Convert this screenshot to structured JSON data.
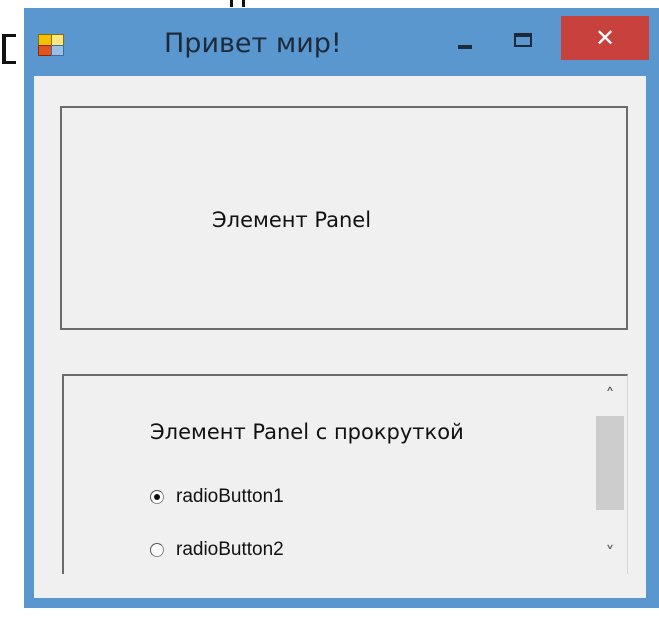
{
  "window": {
    "title": "Привет мир!",
    "close_glyph": "✕"
  },
  "panel1": {
    "label": "Элемент Panel"
  },
  "panel2": {
    "label": "Элемент Panel с прокруткой",
    "radios": [
      {
        "label": "radioButton1",
        "checked": true
      },
      {
        "label": "radioButton2",
        "checked": false
      }
    ],
    "scroll": {
      "up_glyph": "˄",
      "down_glyph": "˅"
    }
  },
  "colors": {
    "frame": "#5b97cf",
    "client": "#f0f0f0",
    "close_button": "#c9413c"
  },
  "icons": [
    "app-icon",
    "minimize-icon",
    "maximize-icon",
    "close-icon",
    "radio-icon",
    "chevron-up-icon",
    "chevron-down-icon"
  ]
}
